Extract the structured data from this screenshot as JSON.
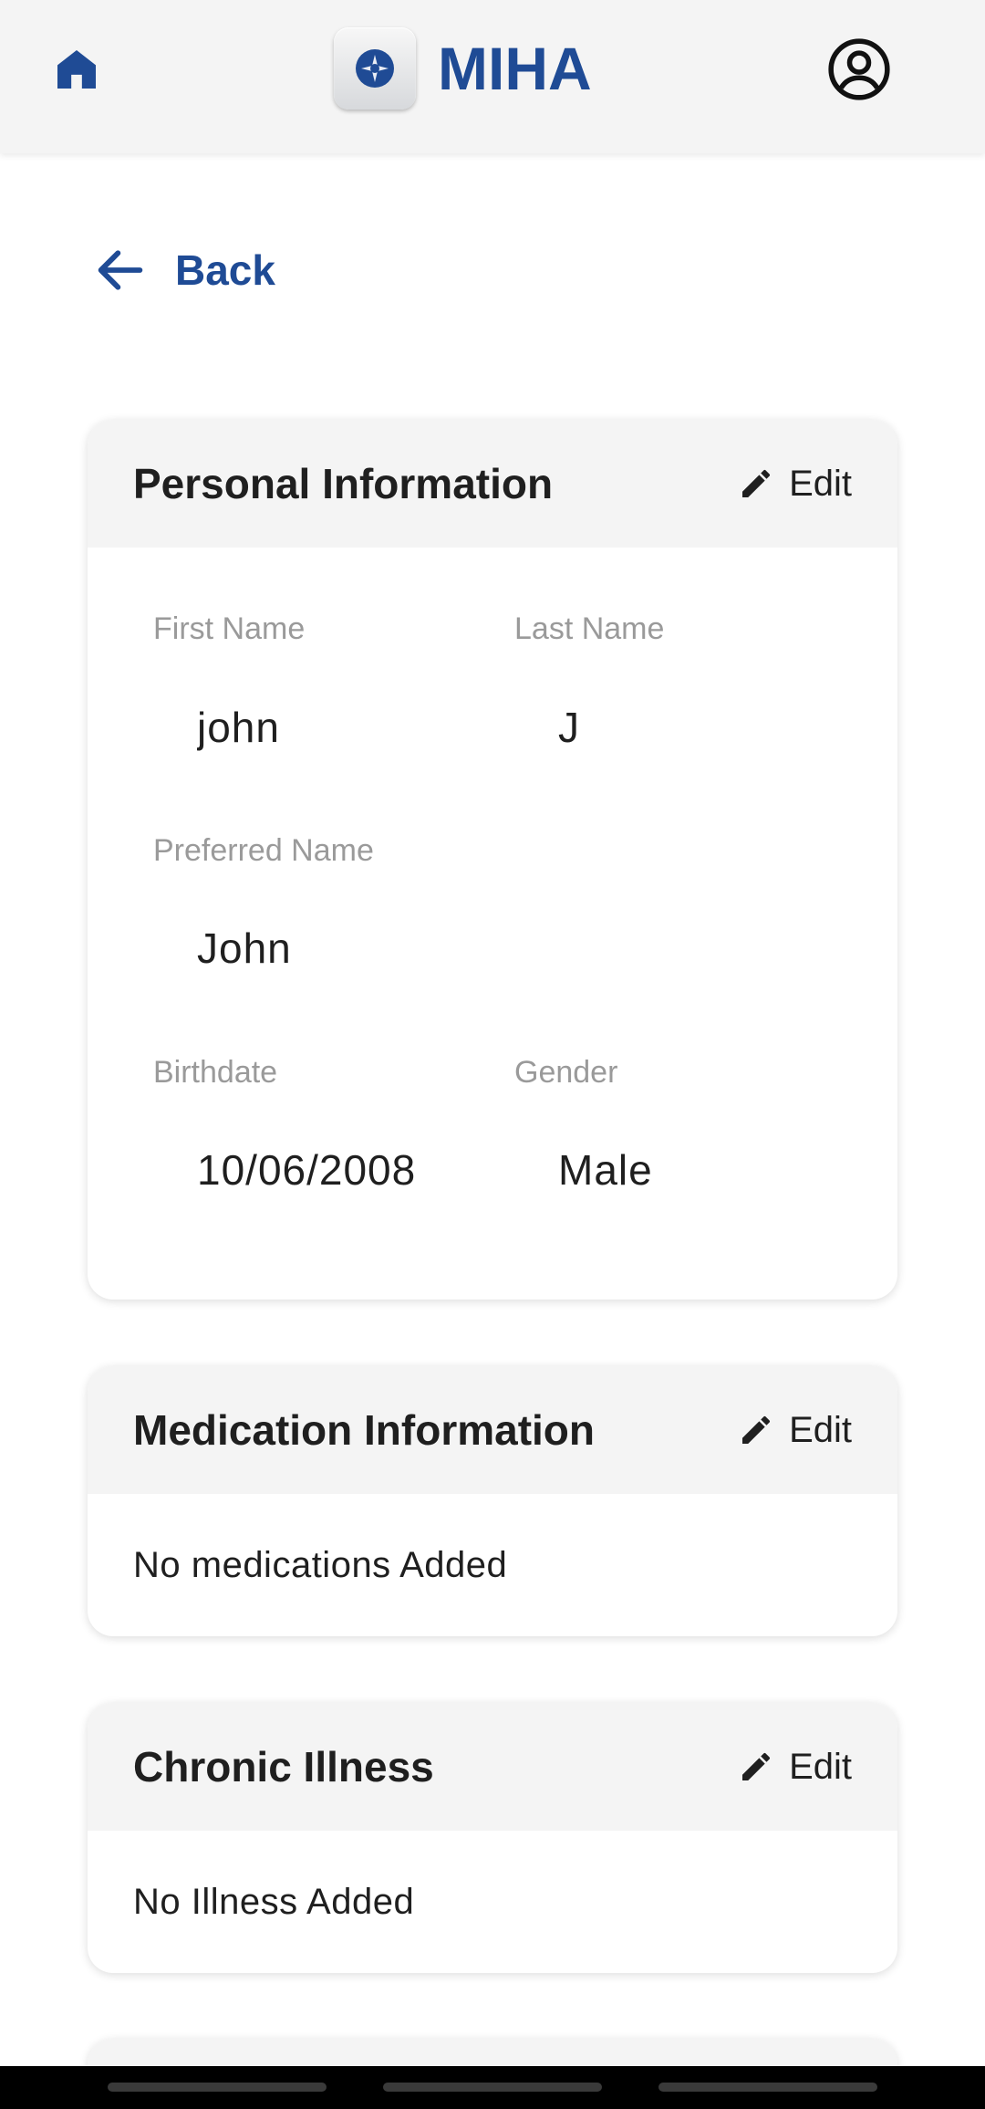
{
  "header": {
    "app_name": "MIHA",
    "home_icon": "home-icon",
    "profile_icon": "account-circle-icon",
    "brand_color": "#1f4b95"
  },
  "back": {
    "label": "Back"
  },
  "personal_info": {
    "title": "Personal Information",
    "edit_label": "Edit",
    "fields": {
      "first_name": {
        "label": "First Name",
        "value": "john"
      },
      "last_name": {
        "label": "Last Name",
        "value": "J"
      },
      "preferred_name": {
        "label": "Preferred Name",
        "value": "John"
      },
      "birthdate": {
        "label": "Birthdate",
        "value": "10/06/2008"
      },
      "gender": {
        "label": "Gender",
        "value": "Male"
      }
    }
  },
  "medication": {
    "title": "Medication Information",
    "edit_label": "Edit",
    "empty_text": "No medications Added"
  },
  "chronic_illness": {
    "title": "Chronic Illness",
    "edit_label": "Edit",
    "empty_text": "No Illness Added"
  }
}
